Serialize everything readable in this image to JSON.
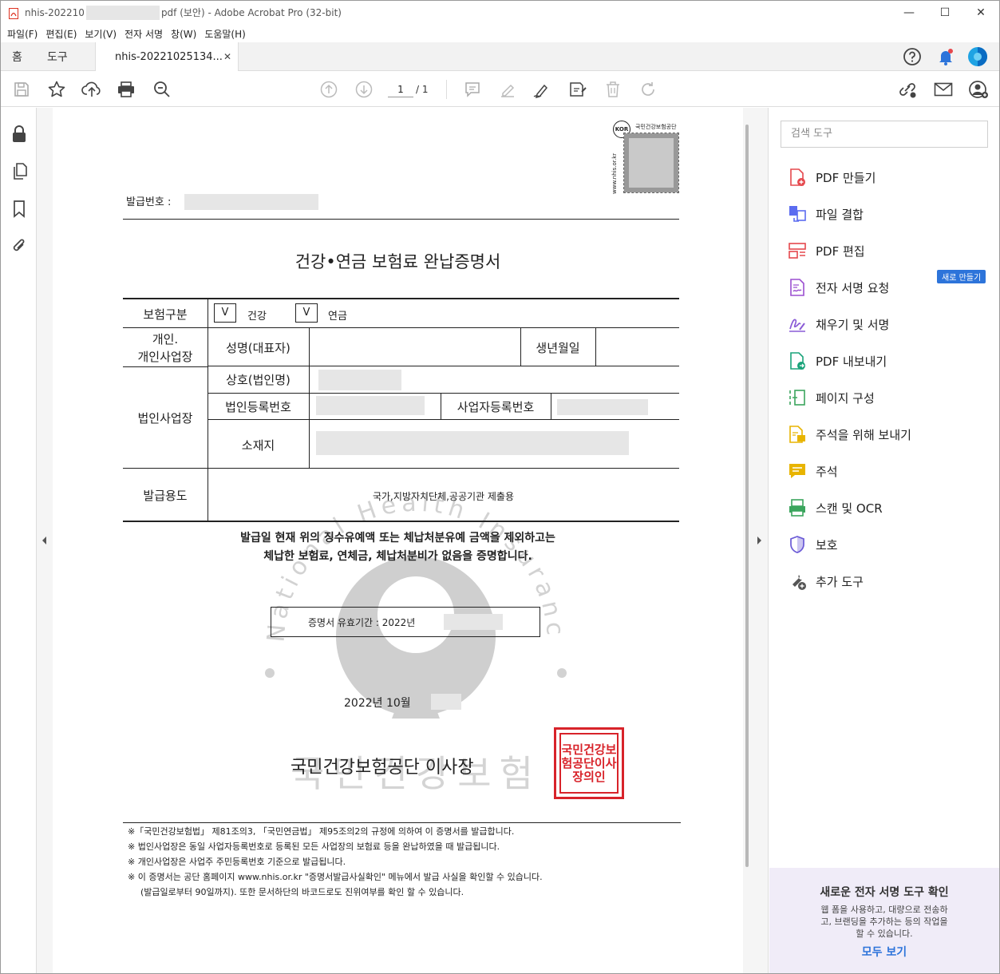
{
  "window": {
    "title_prefix": "nhis-202210",
    "title_suffix": "pdf (보안) - Adobe Acrobat Pro (32-bit)",
    "minimize": "—",
    "maximize": "☐",
    "close": "✕"
  },
  "menu": [
    "파일(F)",
    "편집(E)",
    "보기(V)",
    "전자 서명",
    "창(W)",
    "도움말(H)"
  ],
  "tabs": {
    "home": "홈",
    "tools": "도구",
    "document": "nhis-20221025134...",
    "close": "✕"
  },
  "toolbar": {
    "page_current": "1",
    "page_total": "/ 1"
  },
  "document": {
    "issue_no_label": "발급번호 :",
    "qr_caption": "국민건강보험공단",
    "qr_side": "www.nhis.or.kr",
    "qr_badge": "KOR",
    "title": "건강•연금 보험료 완납증명서",
    "row_insurance_label": "보험구분",
    "check_mark": "V",
    "check_health": "건강",
    "check_pension": "연금",
    "individual_label_1": "개인.",
    "individual_label_2": "개인사업장",
    "name_label": "성명(대표자)",
    "birth_label": "생년월일",
    "corp_label": "법인사업장",
    "trade_label": "상호(법인명)",
    "corp_reg_label": "법인등록번호",
    "biz_reg_label": "사업자등록번호",
    "address_label": "소재지",
    "purpose_label": "발급용도",
    "purpose_value": "국가,지방자치단체,공공기관 제출용",
    "statement_1": "발급일 현재 위의 징수유예액 또는 체납처분유예 금액을 제외하고는",
    "statement_2": "체납한 보험료, 연체금, 체납처분비가 없음을 증명합니다.",
    "validity": "증명서 유효기간 : 2022년",
    "date": "2022년 10월",
    "issuer": "국민건강보험공단 이사장",
    "seal_text": "국민건강보험공단이사장의인",
    "watermark_arc": "National Health Insurance Service",
    "watermark_kr": "국민건강보험",
    "notes": [
      "※「국민건강보험법」 제81조의3, 「국민연금법」 제95조의2의 규정에 의하여 이 증명서를 발급합니다.",
      "※ 법인사업장은 동일 사업자등록번호로 등록된 모든 사업장의 보험료 등을 완납하였을 때 발급됩니다.",
      "※ 개인사업장은 사업주 주민등록번호 기준으로 발급됩니다.",
      "※ 이 증명서는 공단 홈페이지 www.nhis.or.kr \"증명서발급사실확인\" 메뉴에서 발급 사실을 확인할 수 있습니다.",
      "(발급일로부터 90일까지). 또한 문서하단의 바코드로도 진위여부를 확인 할 수 있습니다."
    ]
  },
  "right_panel": {
    "search_placeholder": "검색 도구",
    "new_badge": "새로 만들기",
    "tools": [
      {
        "label": "PDF 만들기",
        "icon": "create-pdf-icon",
        "color": "#e5484d"
      },
      {
        "label": "파일 결합",
        "icon": "combine-files-icon",
        "color": "#5b6cf0"
      },
      {
        "label": "PDF 편집",
        "icon": "edit-pdf-icon",
        "color": "#e5484d"
      },
      {
        "label": "전자 서명 요청",
        "icon": "request-esign-icon",
        "color": "#9b4fd0"
      },
      {
        "label": "채우기 및 서명",
        "icon": "fill-sign-icon",
        "color": "#8a5bd6"
      },
      {
        "label": "PDF 내보내기",
        "icon": "export-pdf-icon",
        "color": "#1aa37a"
      },
      {
        "label": "페이지 구성",
        "icon": "organize-pages-icon",
        "color": "#3ba55d"
      },
      {
        "label": "주석을 위해 보내기",
        "icon": "send-comments-icon",
        "color": "#e8b400"
      },
      {
        "label": "주석",
        "icon": "comment-icon",
        "color": "#e8b400"
      },
      {
        "label": "스캔 및 OCR",
        "icon": "scan-ocr-icon",
        "color": "#3ba55d"
      },
      {
        "label": "보호",
        "icon": "protect-icon",
        "color": "#6a5ad6"
      },
      {
        "label": "추가 도구",
        "icon": "more-tools-icon",
        "color": "#555555"
      }
    ],
    "promo": {
      "title": "새로운 전자 서명 도구 확인",
      "line1": "웹 폼을 사용하고, 대량으로 전송하",
      "line2": "고, 브랜딩을 추가하는 등의 작업을",
      "line3": "할 수 있습니다.",
      "link": "모두 보기"
    }
  },
  "colors": {
    "accent": "#2d74da",
    "seal": "#d8232a",
    "promo_bg": "#f0ecf8"
  }
}
